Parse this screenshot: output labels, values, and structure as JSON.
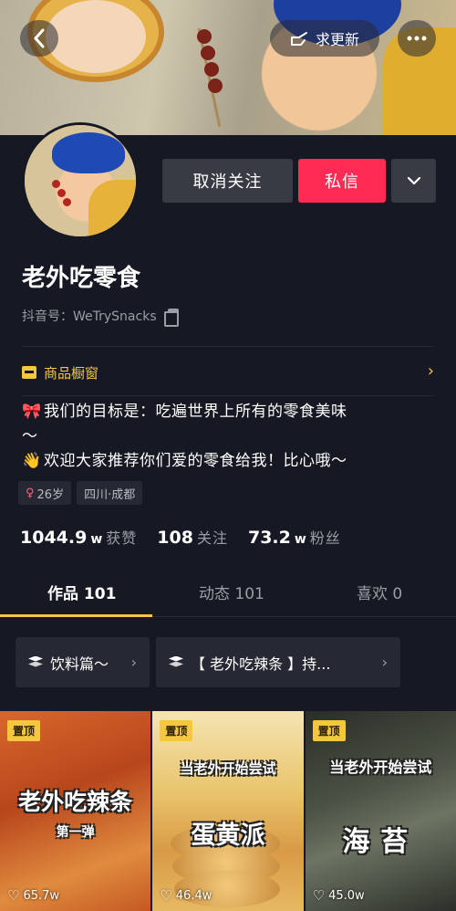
{
  "header": {
    "help_label": "求更新",
    "back_icon": "back-arrow-icon",
    "more_icon": "more-dots-icon"
  },
  "profile": {
    "unfollow_label": "取消关注",
    "message_label": "私信",
    "name": "老外吃零食",
    "douyin_id": "抖音号：WeTrySnacks",
    "shop_label": "商品橱窗",
    "bio_line1": "我们的目标是：吃遍世界上所有的零食美味",
    "bio_line1_cont": "～",
    "bio_line2": "欢迎大家推荐你们爱的零食给我！比心哦～",
    "age_tag": "26岁",
    "location_tag": "四川·成都",
    "stats": {
      "likes_num": "1044.9",
      "likes_unit": "w",
      "likes_label": "获赞",
      "following_num": "108",
      "following_label": "关注",
      "fans_num": "73.2",
      "fans_unit": "w",
      "fans_label": "粉丝"
    }
  },
  "tabs": {
    "works": "作品 101",
    "moments": "动态 101",
    "likes": "喜欢 0"
  },
  "collections": [
    {
      "label": "饮料篇～"
    },
    {
      "label": "【 老外吃辣条 】持..."
    }
  ],
  "videos": [
    {
      "pin": "置顶",
      "title": "老外吃辣条",
      "subtitle": "第一弹",
      "likes": "65.7w"
    },
    {
      "pin": "置顶",
      "title_top": "当老外开始尝试",
      "title": "蛋黄派",
      "likes": "46.4w"
    },
    {
      "pin": "置顶",
      "title_top": "当老外开始尝试",
      "title": "海苔",
      "likes": "45.0w"
    }
  ],
  "colors": {
    "background": "#161823",
    "accent_red": "#fe2c55",
    "accent_yellow": "#f4c73f",
    "button_gray": "#393b44"
  }
}
